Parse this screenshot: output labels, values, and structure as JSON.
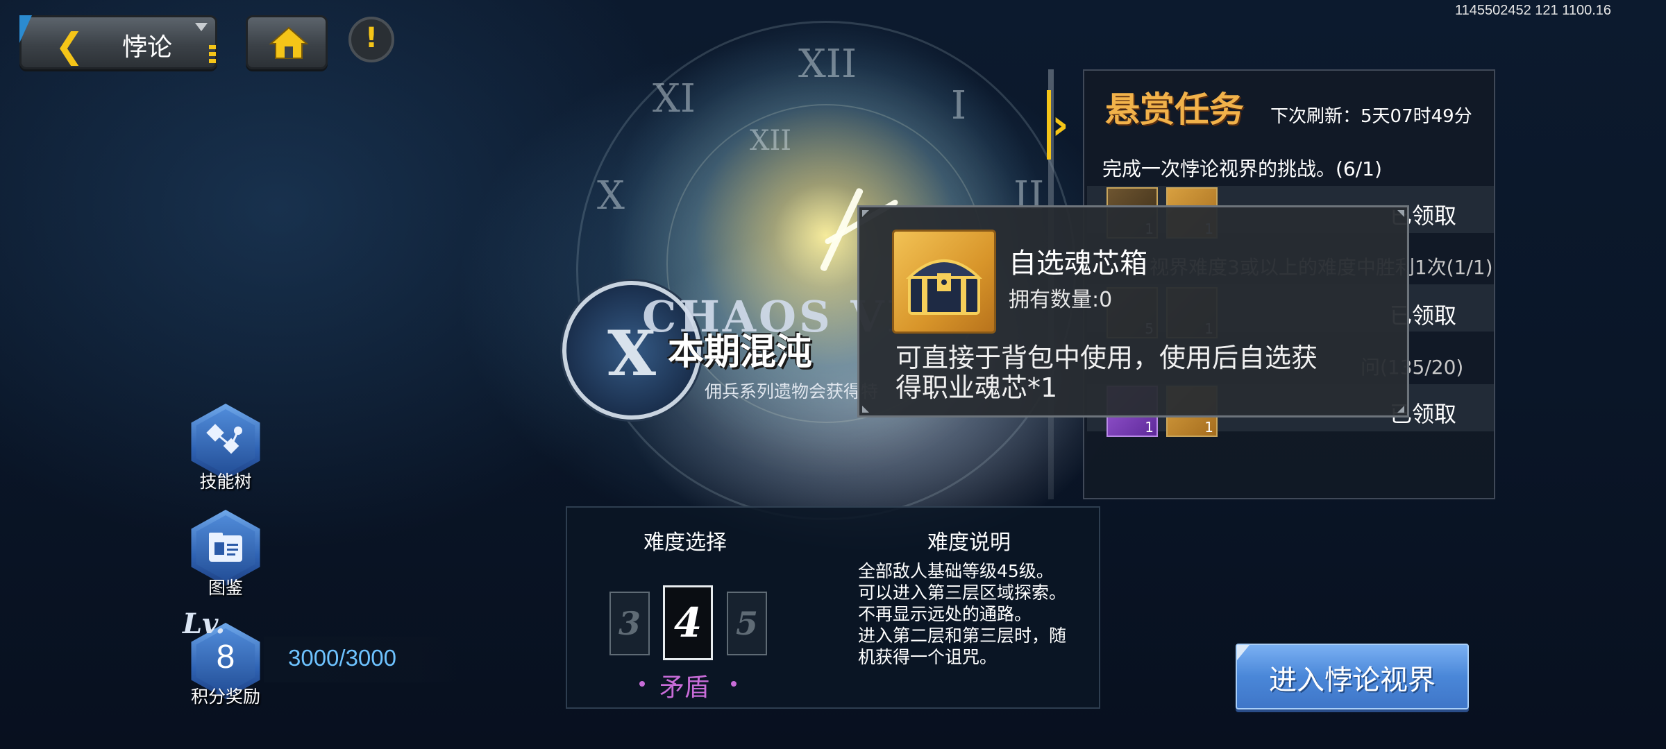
{
  "top_bar": {
    "back_label": "悖论",
    "info_text": "1145502452 121 1100.16"
  },
  "icons": {
    "back": "back-arrow-icon",
    "home": "home-icon",
    "alert": "exclamation-icon",
    "skill_tree": "skill-tree-icon",
    "codex": "codex-icon",
    "chest": "treasure-chest-icon"
  },
  "banner": {
    "title_en": "CHAOS VE",
    "title_cn": "本期混沌",
    "subtitle": "佣兵系列遗物会获得特"
  },
  "side_menu": {
    "skill_tree_label": "技能树",
    "codex_label": "图鉴",
    "level_prefix": "Lv.",
    "level": "8",
    "points_label": "积分奖励",
    "points_progress": "3000/3000"
  },
  "difficulty": {
    "select_title": "难度选择",
    "desc_title": "难度说明",
    "prev": "3",
    "current": "4",
    "next": "5",
    "name": "矛盾",
    "description": [
      "全部敌人基础等级45级。",
      "可以进入第三层区域探索。",
      "不再显示远处的通路。",
      "进入第二层和第三层时，随",
      "机获得一个诅咒。"
    ]
  },
  "enter_button": "进入悖论视界",
  "bounty": {
    "title": "悬赏任务",
    "refresh": "下次刷新：5天07时49分",
    "tasks": [
      {
        "title": "完成一次悖论视界的挑战。(6/1)",
        "status": "已领取",
        "rewards": [
          {
            "count": "1"
          },
          {
            "count": "1"
          }
        ]
      },
      {
        "title": "视界难度3或以上的难度中胜利1次(1/1)",
        "status": "已领取",
        "rewards": [
          {
            "count": "5"
          },
          {
            "count": "1"
          }
        ]
      },
      {
        "title": "问(135/20)",
        "status": "已领取",
        "rewards": [
          {
            "count": "1"
          },
          {
            "count": "1"
          }
        ]
      }
    ]
  },
  "popup": {
    "item_name": "自选魂芯箱",
    "owned": "拥有数量:0",
    "desc_line1": "可直接于背包中使用，使用后自选获",
    "desc_line2": "得职业魂芯*1"
  },
  "colors": {
    "accent_gold": "#f5c518",
    "difficulty_purple": "#c86cd8",
    "points_blue": "#6ec3ff",
    "bounty_title": "#f2b24a"
  }
}
